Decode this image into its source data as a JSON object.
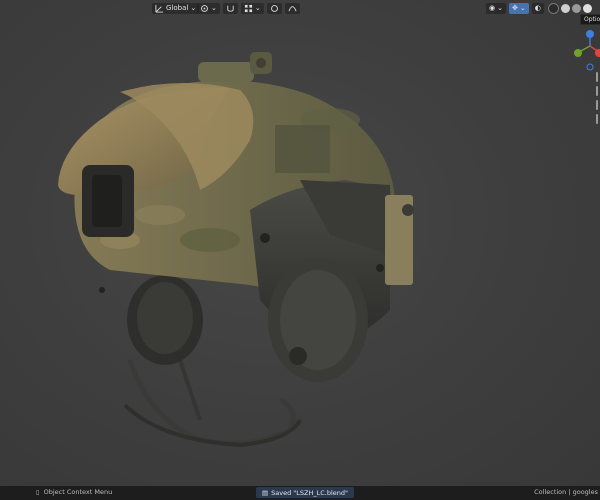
{
  "header": {
    "transform_orientation": "Global",
    "pivot_icon": "pivot-icon",
    "snap_icon": "snap-icon",
    "proportional_icon": "proportional-editing-icon"
  },
  "viewport": {
    "tooltip": "Option",
    "gizmo": {
      "z_label": "",
      "x_label": "",
      "y_label": ""
    },
    "scene_object": "tactical helmet model with camouflage cover and headset"
  },
  "statusbar": {
    "context_menu": "Object Context Menu",
    "saved_message": "Saved \"LSZH_LC.blend\"",
    "collection": "Collection | googles"
  },
  "colors": {
    "accent": "#4772b3",
    "axis_x": "#e0453a",
    "axis_y": "#6ea32a",
    "axis_z": "#3f7fe0"
  }
}
